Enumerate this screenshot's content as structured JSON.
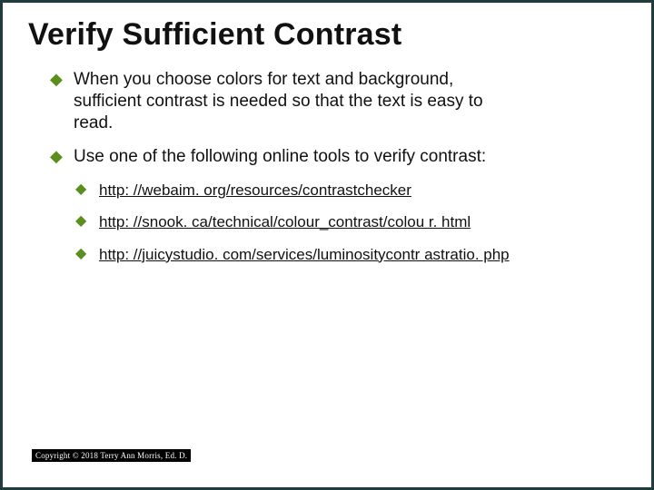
{
  "title": "Verify Sufficient Contrast",
  "bullets": [
    {
      "text": "When you choose colors for text and background,\nsufficient contrast is needed so that the text is easy to read."
    },
    {
      "text": "Use one of the following online tools to verify contrast:"
    }
  ],
  "links": [
    {
      "text": "http: //webaim. org/resources/contrastchecker"
    },
    {
      "text": "http: //snook. ca/technical/colour_contrast/colou r. html"
    },
    {
      "text": "http: //juicystudio. com/services/luminositycontr astratio. php"
    }
  ],
  "footer": "Copyright © 2018 Terry Ann Morris, Ed. D."
}
